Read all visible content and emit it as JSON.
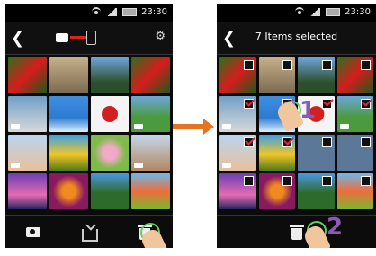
{
  "left_phone": {
    "time": "23:30",
    "grid_tiles": [
      "red flower",
      "beach",
      "palm tree",
      "red flower",
      "video clip",
      "blue sky",
      "red hat",
      "nature",
      "portrait",
      "sunflower",
      "pink flower",
      "family",
      "eiffel tower",
      "orange flower",
      "tree",
      "balloons"
    ]
  },
  "right_phone": {
    "time": "23:30",
    "header_title": "7 Items selected",
    "grid_tiles": [
      "red flower",
      "beach",
      "palm tree",
      "red flower",
      "video clip",
      "blue sky",
      "red hat",
      "nature",
      "portrait",
      "sunflower",
      "pink flower",
      "family",
      "eiffel tower",
      "orange flower",
      "tree",
      "balloons"
    ]
  },
  "steps": {
    "one": "1",
    "two": "2"
  },
  "colors": {
    "arrow": "#e8731f",
    "step_number": "#8a5ab6",
    "check": "#e23333"
  }
}
